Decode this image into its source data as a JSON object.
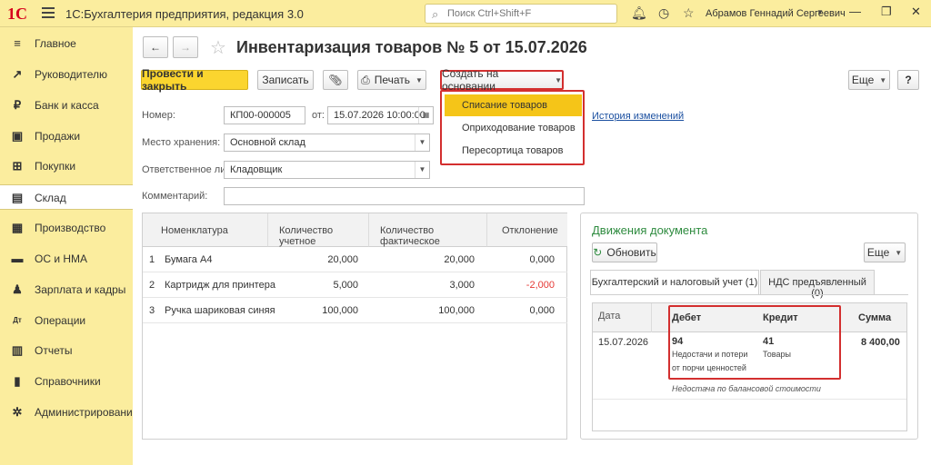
{
  "app": {
    "logo": "1С",
    "title": "1С:Бухгалтерия предприятия, редакция 3.0",
    "search_placeholder": "Поиск Ctrl+Shift+F",
    "user": "Абрамов Геннадий Сергеевич"
  },
  "sidebar": {
    "items": [
      {
        "label": "Главное",
        "icon": "menu-icon",
        "glyph": "≡"
      },
      {
        "label": "Руководителю",
        "icon": "trend-icon",
        "glyph": "↗"
      },
      {
        "label": "Банк и касса",
        "icon": "ruble-icon",
        "glyph": "₽"
      },
      {
        "label": "Продажи",
        "icon": "bag-icon",
        "glyph": "▣"
      },
      {
        "label": "Покупки",
        "icon": "cart-icon",
        "glyph": "⊞"
      },
      {
        "label": "Склад",
        "icon": "warehouse-icon",
        "glyph": "▤"
      },
      {
        "label": "Производство",
        "icon": "factory-icon",
        "glyph": "▦"
      },
      {
        "label": "ОС и НМА",
        "icon": "truck-icon",
        "glyph": "▬"
      },
      {
        "label": "Зарплата и кадры",
        "icon": "person-icon",
        "glyph": "♟"
      },
      {
        "label": "Операции",
        "icon": "dt-kt-icon",
        "glyph": "Дт"
      },
      {
        "label": "Отчеты",
        "icon": "bar-chart-icon",
        "glyph": "▥"
      },
      {
        "label": "Справочники",
        "icon": "book-icon",
        "glyph": "▮"
      },
      {
        "label": "Администрирование",
        "icon": "gear-icon",
        "glyph": "✲"
      }
    ],
    "active": "Склад"
  },
  "document": {
    "title": "Инвентаризация товаров № 5 от 15.07.2026",
    "toolbar": {
      "post_close": "Провести и закрыть",
      "save": "Записать",
      "print": "Печать",
      "create_based": "Создать на основании",
      "more": "Еще",
      "help": "?"
    },
    "dropdown": [
      "Списание товаров",
      "Оприходование товаров",
      "Пересортица товаров"
    ],
    "fields": {
      "number_label": "Номер:",
      "number": "КП00-000005",
      "date_label": "от:",
      "date": "15.07.2026 10:00:00",
      "storage_label": "Место хранения:",
      "storage": "Основной склад",
      "responsible_label": "Ответственное лицо:",
      "responsible": "Кладовщик",
      "comment_label": "Комментарий:",
      "comment": ""
    },
    "history_link": "История изменений",
    "table": {
      "headers": [
        "Номенклатура",
        "Количество учетное",
        "Количество фактическое",
        "Отклонение"
      ],
      "rows": [
        {
          "n": "1",
          "name": "Бумага А4",
          "qty_acc": "20,000",
          "qty_fact": "20,000",
          "dev": "0,000"
        },
        {
          "n": "2",
          "name": "Картридж для принтера",
          "qty_acc": "5,000",
          "qty_fact": "3,000",
          "dev": "-2,000"
        },
        {
          "n": "3",
          "name": "Ручка шариковая синяя",
          "qty_acc": "100,000",
          "qty_fact": "100,000",
          "dev": "0,000"
        }
      ]
    }
  },
  "movements": {
    "title": "Движения документа",
    "refresh": "Обновить",
    "more": "Еще",
    "tabs": [
      "Бухгалтерский и налоговый учет (1)",
      "НДС предъявленный (0)"
    ],
    "headers": {
      "date": "Дата",
      "debit": "Дебет",
      "credit": "Кредит",
      "sum": "Сумма"
    },
    "entry": {
      "date": "15.07.2026",
      "debit_acc": "94",
      "debit_name_1": "Недостачи и потери",
      "debit_name_2": "от порчи ценностей",
      "credit_acc": "41",
      "credit_name": "Товары",
      "sum": "8 400,00",
      "description": "Недостача по балансовой стоимости"
    }
  },
  "colors": {
    "accent_yellow": "#fbd52f",
    "highlight": "#f5c518",
    "red_box": "#d32f2f",
    "negative": "#e53935",
    "green_title": "#2e8b3f"
  }
}
